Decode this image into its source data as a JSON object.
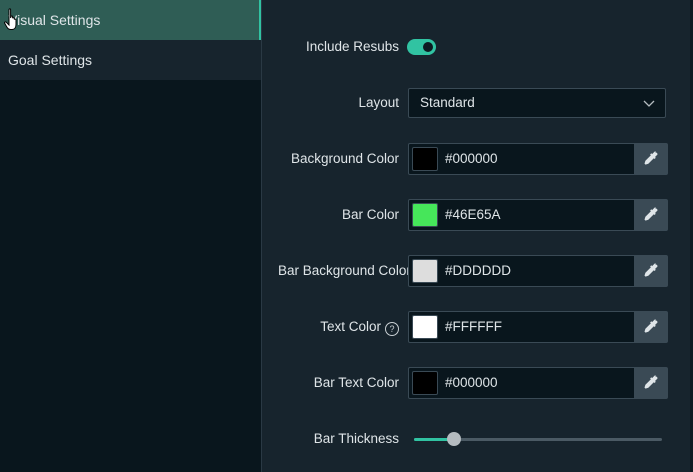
{
  "sidebar": {
    "items": [
      {
        "label": "Visual Settings",
        "active": true
      },
      {
        "label": "Goal Settings",
        "active": false
      }
    ]
  },
  "settings": {
    "include_resubs": {
      "label": "Include Resubs",
      "enabled": true
    },
    "layout": {
      "label": "Layout",
      "value": "Standard"
    },
    "background_color": {
      "label": "Background Color",
      "value": "#000000",
      "swatch": "#000000"
    },
    "bar_color": {
      "label": "Bar Color",
      "value": "#46E65A",
      "swatch": "#46E65A"
    },
    "bar_background_color": {
      "label": "Bar Background Color",
      "value": "#DDDDDD",
      "swatch": "#DDDDDD"
    },
    "text_color": {
      "label": "Text Color",
      "value": "#FFFFFF",
      "swatch": "#FFFFFF"
    },
    "bar_text_color": {
      "label": "Bar Text Color",
      "value": "#000000",
      "swatch": "#000000"
    },
    "bar_thickness": {
      "label": "Bar Thickness",
      "fraction": 0.16
    }
  },
  "icons": {
    "help": "?",
    "picker": "eyedropper-icon",
    "chevron": "chevron-down-icon",
    "cursor": "hand-pointer-icon"
  },
  "colors": {
    "accent": "#31C3A2",
    "active_bg": "#2F5D55",
    "panel_bg": "#17242D",
    "sidebar_bg": "#09161D"
  }
}
